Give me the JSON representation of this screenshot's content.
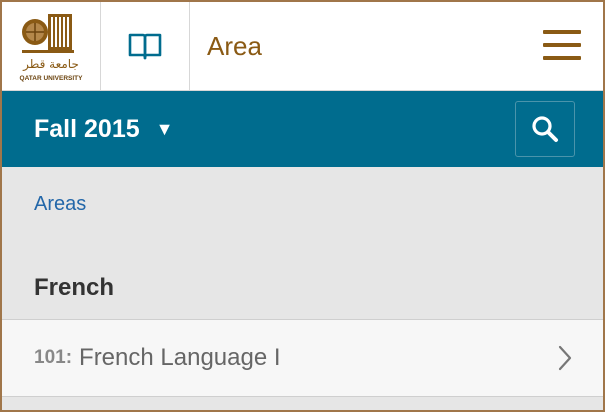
{
  "header": {
    "logo": {
      "arabic_text": "جامعة قطر",
      "english_text": "QATAR UNIVERSITY",
      "icon": "qatar-university-logo"
    },
    "book_icon": "book-icon",
    "title": "Area",
    "menu_icon": "menu-icon"
  },
  "termbar": {
    "term": "Fall 2015",
    "caret": "▼",
    "search_icon": "search-icon"
  },
  "breadcrumb": {
    "link": "Areas"
  },
  "section": {
    "heading": "French"
  },
  "courses": [
    {
      "code": "101:",
      "name": "French Language I",
      "chevron_icon": "chevron-right-icon"
    }
  ],
  "colors": {
    "brand_brown": "#8a5a14",
    "term_bar": "#006c8e",
    "link_blue": "#2367a9",
    "frame_border": "#a0764a"
  }
}
